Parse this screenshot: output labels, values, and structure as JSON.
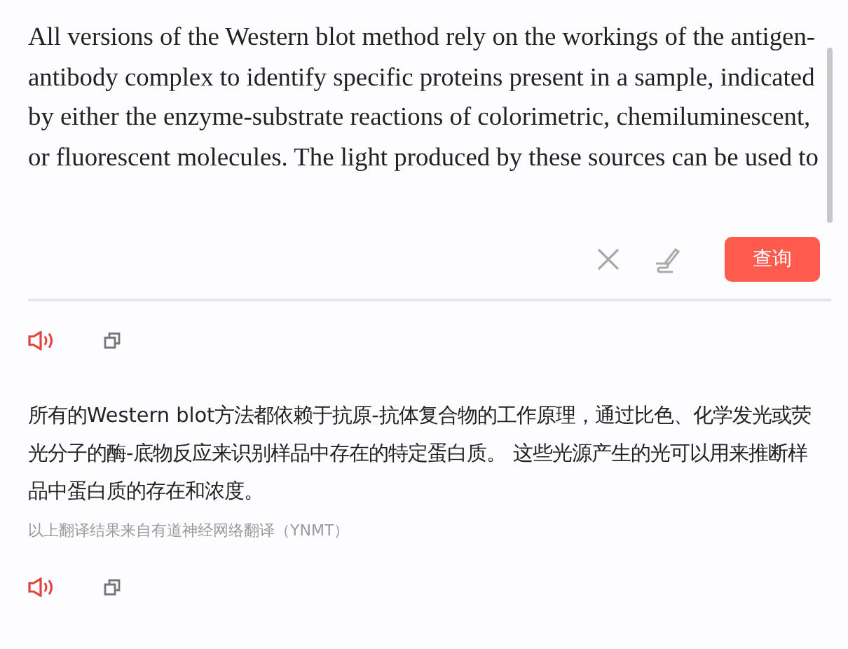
{
  "source": {
    "value": "All versions of the Western blot method rely on the workings of the antigen-antibody complex to identify specific proteins present in a sample, indicated by either the enzyme-substrate reactions of colorimetric, chemiluminescent, or fluorescent molecules.  The light produced by these sources can be used to"
  },
  "query_button": {
    "label": "查询"
  },
  "translation": {
    "text": "所有的Western blot方法都依赖于抗原-抗体复合物的工作原理，通过比色、化学发光或荧光分子的酶-底物反应来识别样品中存在的特定蛋白质。 这些光源产生的光可以用来推断样品中蛋白质的存在和浓度。",
    "attribution": "以上翻译结果来自有道神经网络翻译（YNMT）"
  }
}
